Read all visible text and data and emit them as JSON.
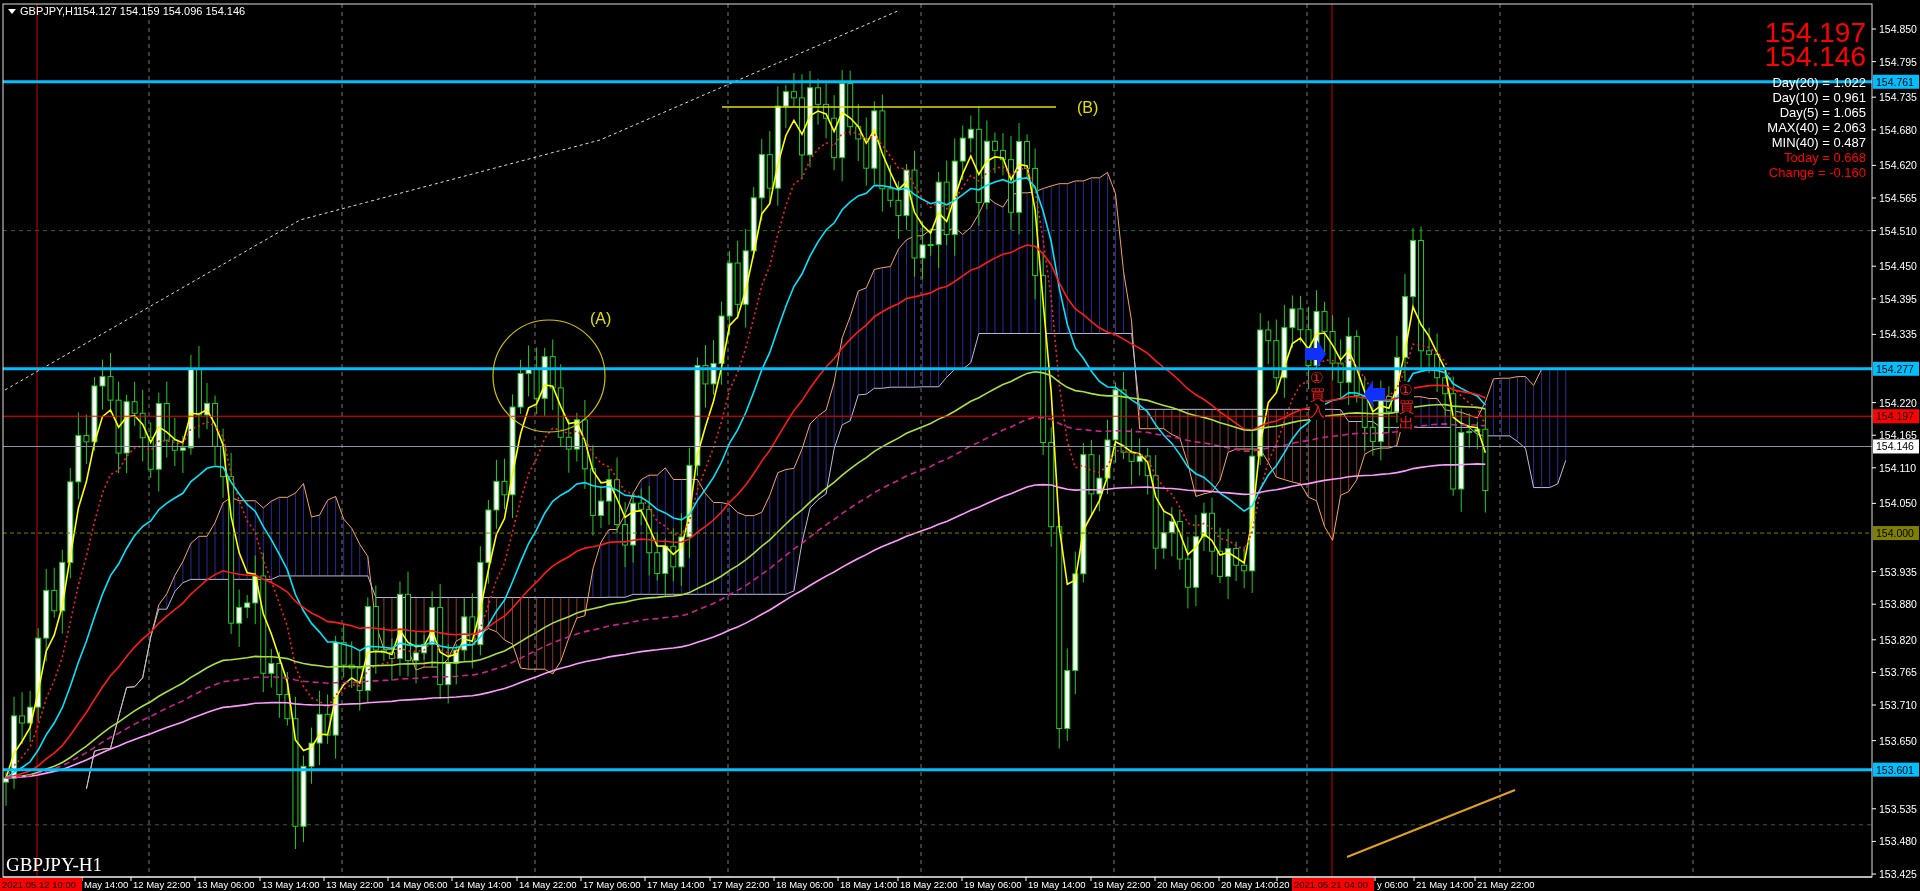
{
  "header": {
    "symbol": "GBPJPY,H1",
    "ohlc": "154.127 154.159 154.096 154.146"
  },
  "quotes": [
    "154.197",
    "154.146"
  ],
  "stats": [
    {
      "text": "Day(20) = 1.022",
      "kind": "normal"
    },
    {
      "text": "Day(10) = 0.961",
      "kind": "normal"
    },
    {
      "text": "Day(5) = 1.065",
      "kind": "normal"
    },
    {
      "text": "MAX(40) = 2.063",
      "kind": "normal"
    },
    {
      "text": "MIN(40) = 0.487",
      "kind": "normal"
    },
    {
      "text": "Today = 0.668",
      "kind": "alert"
    },
    {
      "text": "Change = -0.160",
      "kind": "alert"
    }
  ],
  "price_axis": [
    "154.850",
    "154.795",
    "154.735",
    "154.680",
    "154.620",
    "154.565",
    "154.510",
    "154.450",
    "154.395",
    "154.335",
    "154.220",
    "154.165",
    "154.110",
    "154.050",
    "153.935",
    "153.880",
    "153.820",
    "153.765",
    "153.710",
    "153.650",
    "153.535",
    "153.480",
    "153.425"
  ],
  "price_levels": [
    {
      "label": "154.761",
      "kind": "line"
    },
    {
      "label": "154.277",
      "kind": "line"
    },
    {
      "label": "154.197",
      "kind": "bid"
    },
    {
      "label": "154.146",
      "kind": "last"
    },
    {
      "label": "154.000",
      "kind": "round"
    },
    {
      "label": "153.601",
      "kind": "line"
    }
  ],
  "time_axis": {
    "cursor_labels": [
      "2021.05.12 10:00",
      "2021.05.21 04:00"
    ],
    "labels": [
      "May 14:00",
      "12 May 22:00",
      "13 May 06:00",
      "13 May 14:00",
      "13 May 22:00",
      "14 May 06:00",
      "14 May 14:00",
      "14 May 22:00",
      "17 May 06:00",
      "17 May 14:00",
      "17 May 22:00",
      "18 May 06:00",
      "18 May 14:00",
      "18 May 22:00",
      "19 May 06:00",
      "19 May 14:00",
      "19 May 22:00",
      "20 May 06:00",
      "20 May 14:00",
      "20",
      "y 06:00",
      "21 May 14:00",
      "21 May 22:00"
    ]
  },
  "annotations": [
    "(A)",
    "(B)"
  ],
  "signals": [
    {
      "kind": "buy",
      "text": "①買入"
    },
    {
      "kind": "sell",
      "text": "①買出"
    }
  ],
  "chart_title": "GBPJPY-H1"
}
